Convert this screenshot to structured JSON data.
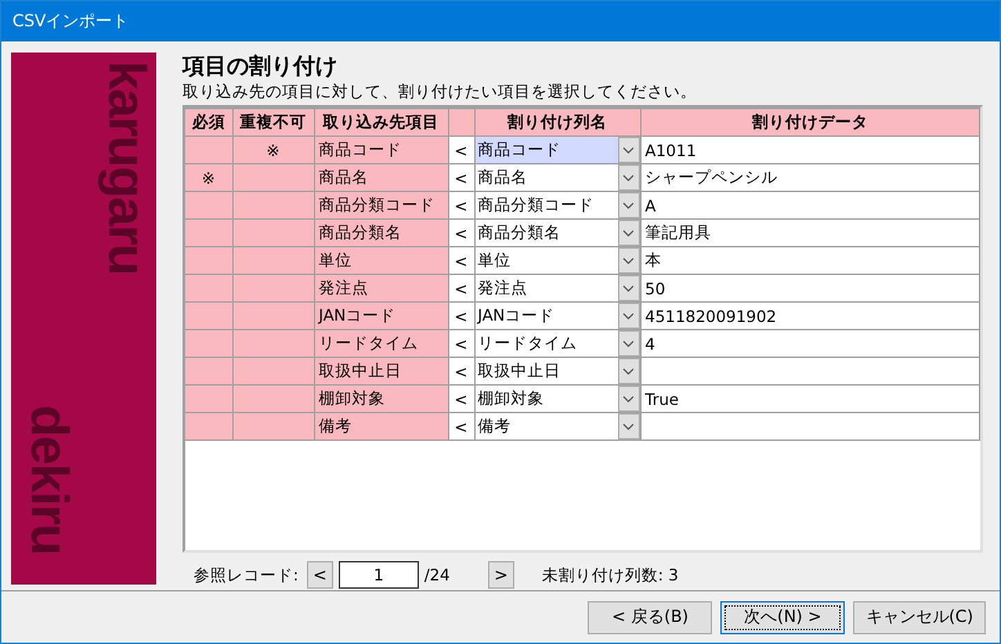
{
  "window": {
    "title": "CSVインポート"
  },
  "banner": {
    "words": [
      "karugaru",
      "dekiru"
    ]
  },
  "heading": "項目の割り付け",
  "instruction": "取り込み先の項目に対して、割り付けたい項目を選択してください。",
  "table": {
    "columns": [
      "必須",
      "重複不可",
      "取り込み先項目",
      "",
      "割り付け列名",
      "割り付けデータ"
    ],
    "rows": [
      {
        "unique": "※",
        "target": "商品コード",
        "arrow": "<",
        "mapped": "商品コード",
        "data": "A1011",
        "selected": true
      },
      {
        "required": "※",
        "target": "商品名",
        "arrow": "<",
        "mapped": "商品名",
        "data": "シャープペンシル",
        "selected": false
      },
      {
        "target": "商品分類コード",
        "arrow": "<",
        "mapped": "商品分類コード",
        "data": "A",
        "selected": false
      },
      {
        "target": "商品分類名",
        "arrow": "<",
        "mapped": "商品分類名",
        "data": "筆記用具",
        "selected": false
      },
      {
        "target": "単位",
        "arrow": "<",
        "mapped": "単位",
        "data": "本",
        "selected": false
      },
      {
        "target": "発注点",
        "arrow": "<",
        "mapped": "発注点",
        "data": "50",
        "selected": false
      },
      {
        "target": "JANコード",
        "arrow": "<",
        "mapped": "JANコード",
        "data": "4511820091902",
        "selected": false
      },
      {
        "target": "リードタイム",
        "arrow": "<",
        "mapped": "リードタイム",
        "data": "4",
        "selected": false
      },
      {
        "target": "取扱中止日",
        "arrow": "<",
        "mapped": "取扱中止日",
        "selected": false
      },
      {
        "target": "棚卸対象",
        "arrow": "<",
        "mapped": "棚卸対象",
        "data": "True",
        "selected": false
      },
      {
        "target": "備考",
        "arrow": "<",
        "mapped": "備考",
        "selected": false
      }
    ]
  },
  "record_nav": {
    "label": "参照レコード:",
    "prev": "<",
    "value": "1",
    "total": "/24",
    "next": ">",
    "unmapped": "未割り付け列数: 3"
  },
  "buttons": [
    {
      "label": "< 戻る(B)",
      "default": false
    },
    {
      "label": "次へ(N) >",
      "default": true
    },
    {
      "label": "キャンセル(C)",
      "default": false
    }
  ]
}
